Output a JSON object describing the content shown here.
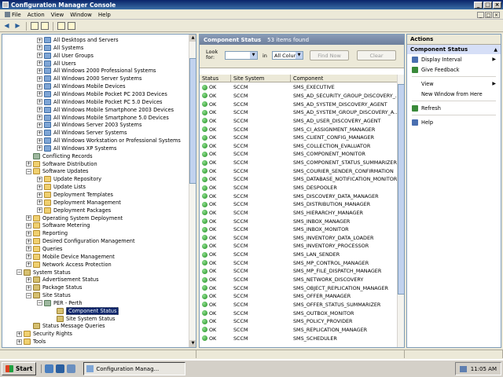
{
  "window": {
    "title": "Configuration Manager Console",
    "controls": [
      "_",
      "□",
      "×"
    ]
  },
  "menubar": {
    "items": [
      "File",
      "Action",
      "View",
      "Window",
      "Help"
    ],
    "mdi_controls": [
      "_",
      "□",
      "×"
    ]
  },
  "toolbar": {
    "buttons": [
      "back-arrow-icon",
      "forward-arrow-icon",
      "up-folder-icon",
      "show-hide-tree-icon",
      "properties-icon",
      "help-icon"
    ]
  },
  "tree": {
    "items": [
      {
        "label": "All Desktops and Servers",
        "indent": 3,
        "icon": "coll",
        "exp": "+"
      },
      {
        "label": "All Systems",
        "indent": 3,
        "icon": "coll",
        "exp": "+"
      },
      {
        "label": "All User Groups",
        "indent": 3,
        "icon": "coll",
        "exp": "+"
      },
      {
        "label": "All Users",
        "indent": 3,
        "icon": "coll",
        "exp": "+"
      },
      {
        "label": "All Windows 2000 Professional Systems",
        "indent": 3,
        "icon": "coll",
        "exp": "+"
      },
      {
        "label": "All Windows 2000 Server Systems",
        "indent": 3,
        "icon": "coll",
        "exp": "+"
      },
      {
        "label": "All Windows Mobile Devices",
        "indent": 3,
        "icon": "coll",
        "exp": "+"
      },
      {
        "label": "All Windows Mobile Pocket PC 2003 Devices",
        "indent": 3,
        "icon": "coll",
        "exp": "+"
      },
      {
        "label": "All Windows Mobile Pocket PC 5.0 Devices",
        "indent": 3,
        "icon": "coll",
        "exp": "+"
      },
      {
        "label": "All Windows Mobile Smartphone 2003 Devices",
        "indent": 3,
        "icon": "coll",
        "exp": "+"
      },
      {
        "label": "All Windows Mobile Smartphone 5.0 Devices",
        "indent": 3,
        "icon": "coll",
        "exp": "+"
      },
      {
        "label": "All Windows Server 2003 Systems",
        "indent": 3,
        "icon": "coll",
        "exp": "+"
      },
      {
        "label": "All Windows Server Systems",
        "indent": 3,
        "icon": "coll",
        "exp": "+"
      },
      {
        "label": "All Windows Workstation or Professional Systems",
        "indent": 3,
        "icon": "coll",
        "exp": "+"
      },
      {
        "label": "All Windows XP Systems",
        "indent": 3,
        "icon": "coll",
        "exp": "+"
      },
      {
        "label": "Conflicting Records",
        "indent": 2,
        "icon": "node",
        "exp": ""
      },
      {
        "label": "Software Distribution",
        "indent": 2,
        "icon": "folder",
        "exp": "+"
      },
      {
        "label": "Software Updates",
        "indent": 2,
        "icon": "folder",
        "exp": "−"
      },
      {
        "label": "Update Repository",
        "indent": 3,
        "icon": "folder",
        "exp": "+"
      },
      {
        "label": "Update Lists",
        "indent": 3,
        "icon": "folder",
        "exp": "+"
      },
      {
        "label": "Deployment Templates",
        "indent": 3,
        "icon": "folder",
        "exp": "+"
      },
      {
        "label": "Deployment Management",
        "indent": 3,
        "icon": "folder",
        "exp": "+"
      },
      {
        "label": "Deployment Packages",
        "indent": 3,
        "icon": "folder",
        "exp": "+"
      },
      {
        "label": "Operating System Deployment",
        "indent": 2,
        "icon": "folder",
        "exp": "+"
      },
      {
        "label": "Software Metering",
        "indent": 2,
        "icon": "folder",
        "exp": "+"
      },
      {
        "label": "Reporting",
        "indent": 2,
        "icon": "folder",
        "exp": "+"
      },
      {
        "label": "Desired Configuration Management",
        "indent": 2,
        "icon": "folder",
        "exp": "+"
      },
      {
        "label": "Queries",
        "indent": 2,
        "icon": "folder",
        "exp": "+"
      },
      {
        "label": "Mobile Device Management",
        "indent": 2,
        "icon": "folder",
        "exp": "+"
      },
      {
        "label": "Network Access Protection",
        "indent": 2,
        "icon": "folder",
        "exp": "+"
      },
      {
        "label": "System Status",
        "indent": 1,
        "icon": "status",
        "exp": "−"
      },
      {
        "label": "Advertisement Status",
        "indent": 2,
        "icon": "status",
        "exp": "+"
      },
      {
        "label": "Package Status",
        "indent": 2,
        "icon": "status",
        "exp": "+"
      },
      {
        "label": "Site Status",
        "indent": 2,
        "icon": "status",
        "exp": "−"
      },
      {
        "label": "PER - Perth",
        "indent": 3,
        "icon": "node",
        "exp": "−"
      },
      {
        "label": "Component Status",
        "indent": 4,
        "icon": "status",
        "exp": "",
        "selected": true
      },
      {
        "label": "Site System Status",
        "indent": 4,
        "icon": "status",
        "exp": ""
      },
      {
        "label": "Status Message Queries",
        "indent": 2,
        "icon": "status",
        "exp": ""
      },
      {
        "label": "Security Rights",
        "indent": 1,
        "icon": "folder",
        "exp": "+"
      },
      {
        "label": "Tools",
        "indent": 1,
        "icon": "folder",
        "exp": "+"
      }
    ]
  },
  "center": {
    "header_title": "Component Status",
    "header_count": "53 items found",
    "search": {
      "look_for_label": "Look for:",
      "in_label": "in",
      "in_value": "All Colum",
      "find_now": "Find Now",
      "clear": "Clear"
    },
    "columns": [
      "Status",
      "Site System",
      "Component"
    ],
    "rows": [
      [
        "OK",
        "SCCM",
        "SMS_EXECUTIVE"
      ],
      [
        "OK",
        "SCCM",
        "SMS_AD_SECURITY_GROUP_DISCOVERY_..."
      ],
      [
        "OK",
        "SCCM",
        "SMS_AD_SYSTEM_DISCOVERY_AGENT"
      ],
      [
        "OK",
        "SCCM",
        "SMS_AD_SYSTEM_GROUP_DISCOVERY_A..."
      ],
      [
        "OK",
        "SCCM",
        "SMS_AD_USER_DISCOVERY_AGENT"
      ],
      [
        "OK",
        "SCCM",
        "SMS_CI_ASSIGNMENT_MANAGER"
      ],
      [
        "OK",
        "SCCM",
        "SMS_CLIENT_CONFIG_MANAGER"
      ],
      [
        "OK",
        "SCCM",
        "SMS_COLLECTION_EVALUATOR"
      ],
      [
        "OK",
        "SCCM",
        "SMS_COMPONENT_MONITOR"
      ],
      [
        "OK",
        "SCCM",
        "SMS_COMPONENT_STATUS_SUMMARIZER"
      ],
      [
        "OK",
        "SCCM",
        "SMS_COURIER_SENDER_CONFIRMATION"
      ],
      [
        "OK",
        "SCCM",
        "SMS_DATABASE_NOTIFICATION_MONITOR"
      ],
      [
        "OK",
        "SCCM",
        "SMS_DESPOOLER"
      ],
      [
        "OK",
        "SCCM",
        "SMS_DISCOVERY_DATA_MANAGER"
      ],
      [
        "OK",
        "SCCM",
        "SMS_DISTRIBUTION_MANAGER"
      ],
      [
        "OK",
        "SCCM",
        "SMS_HIERARCHY_MANAGER"
      ],
      [
        "OK",
        "SCCM",
        "SMS_INBOX_MANAGER"
      ],
      [
        "OK",
        "SCCM",
        "SMS_INBOX_MONITOR"
      ],
      [
        "OK",
        "SCCM",
        "SMS_INVENTORY_DATA_LOADER"
      ],
      [
        "OK",
        "SCCM",
        "SMS_INVENTORY_PROCESSOR"
      ],
      [
        "OK",
        "SCCM",
        "SMS_LAN_SENDER"
      ],
      [
        "OK",
        "SCCM",
        "SMS_MP_CONTROL_MANAGER"
      ],
      [
        "OK",
        "SCCM",
        "SMS_MP_FILE_DISPATCH_MANAGER"
      ],
      [
        "OK",
        "SCCM",
        "SMS_NETWORK_DISCOVERY"
      ],
      [
        "OK",
        "SCCM",
        "SMS_OBJECT_REPLICATION_MANAGER"
      ],
      [
        "OK",
        "SCCM",
        "SMS_OFFER_MANAGER"
      ],
      [
        "OK",
        "SCCM",
        "SMS_OFFER_STATUS_SUMMARIZER"
      ],
      [
        "OK",
        "SCCM",
        "SMS_OUTBOX_MONITOR"
      ],
      [
        "OK",
        "SCCM",
        "SMS_POLICY_PROVIDER"
      ],
      [
        "OK",
        "SCCM",
        "SMS_REPLICATION_MANAGER"
      ],
      [
        "OK",
        "SCCM",
        "SMS_SCHEDULER"
      ]
    ]
  },
  "actions": {
    "title": "Actions",
    "section": "Component Status",
    "items": [
      {
        "label": "Display Interval",
        "icon": "display-interval-icon",
        "color": "#4a6fb0",
        "submenu": true
      },
      {
        "label": "Give Feedback",
        "icon": "feedback-icon",
        "color": "#3a8a3a",
        "submenu": false
      },
      {
        "sep": true
      },
      {
        "label": "View",
        "icon": "",
        "submenu": true
      },
      {
        "label": "New Window from Here",
        "icon": "",
        "submenu": false
      },
      {
        "sep": true
      },
      {
        "label": "Refresh",
        "icon": "refresh-icon",
        "color": "#3a8a3a",
        "submenu": false
      },
      {
        "sep": true
      },
      {
        "label": "Help",
        "icon": "help-icon",
        "color": "#4a6fb0",
        "submenu": false
      }
    ]
  },
  "taskbar": {
    "start": "Start",
    "task": "Configuration Manag...",
    "clock": "11:05 AM"
  },
  "colors": {
    "ok": "#1d8a1d",
    "title_bar": "#0a246a",
    "selection": "#0a246a"
  }
}
